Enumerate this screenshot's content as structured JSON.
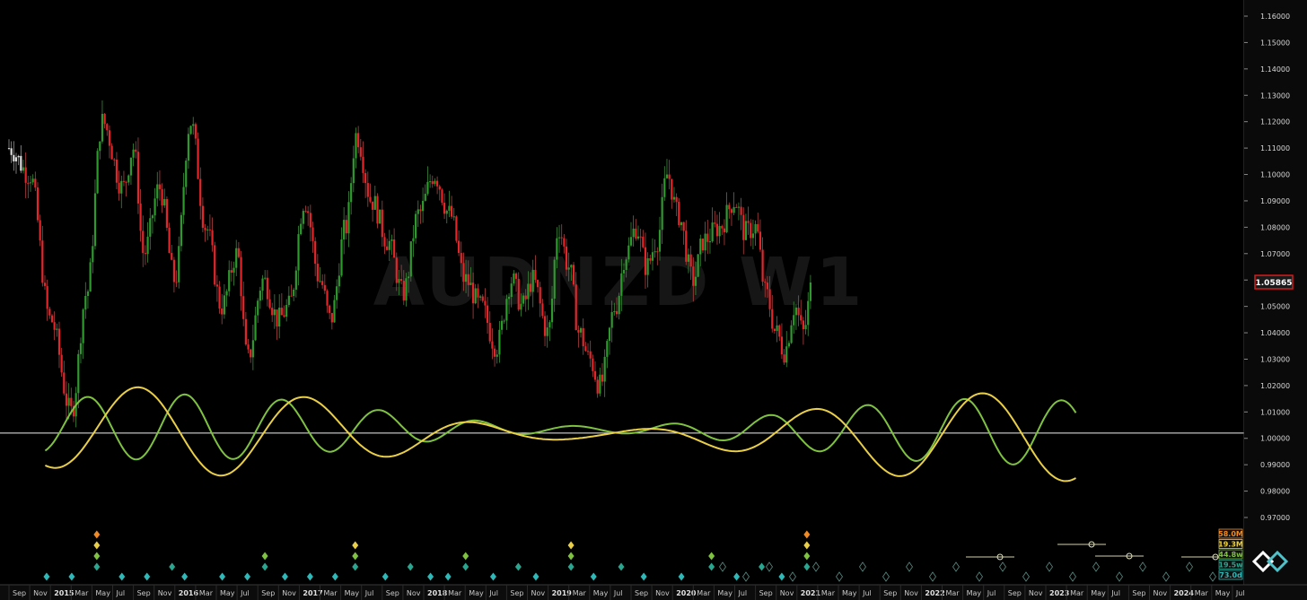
{
  "watermark": "AUDNZD W1",
  "current_price_label": "1.05865",
  "colors": {
    "background": "#000000",
    "bull": "#2e9a2e",
    "bear": "#e3262a",
    "wave_green": "#7fc241",
    "wave_yellow": "#e9cf48",
    "zero_line": "#f0f0f0",
    "price_tag_border": "#d21d1d",
    "marker_orange": "#f08a24",
    "marker_yellow": "#e9cf48",
    "marker_green": "#7fc241",
    "marker_teal": "#2aa58f",
    "marker_cyan": "#2fb8b8"
  },
  "chart_data": {
    "type": "line",
    "title": "AUDNZD W1",
    "y_axis": {
      "ticks": [
        "1.16000",
        "1.15000",
        "1.14000",
        "1.13000",
        "1.12000",
        "1.11000",
        "1.10000",
        "1.09000",
        "1.08000",
        "1.07000",
        "1.06000",
        "1.05000",
        "1.04000",
        "1.03000",
        "1.02000",
        "1.01000",
        "1.00000",
        "0.99000",
        "0.98000",
        "0.97000"
      ],
      "range": [
        0.963,
        1.166
      ]
    },
    "x_axis": {
      "labels": [
        {
          "text": "Sep",
          "year": false
        },
        {
          "text": "Nov",
          "year": false
        },
        {
          "text": "2015",
          "year": true
        },
        {
          "text": "Mar",
          "year": false
        },
        {
          "text": "May",
          "year": false
        },
        {
          "text": "Jul",
          "year": false
        },
        {
          "text": "Sep",
          "year": false
        },
        {
          "text": "Nov",
          "year": false
        },
        {
          "text": "2016",
          "year": true
        },
        {
          "text": "Mar",
          "year": false
        },
        {
          "text": "May",
          "year": false
        },
        {
          "text": "Jul",
          "year": false
        },
        {
          "text": "Sep",
          "year": false
        },
        {
          "text": "Nov",
          "year": false
        },
        {
          "text": "2017",
          "year": true
        },
        {
          "text": "Mar",
          "year": false
        },
        {
          "text": "May",
          "year": false
        },
        {
          "text": "Jul",
          "year": false
        },
        {
          "text": "Sep",
          "year": false
        },
        {
          "text": "Nov",
          "year": false
        },
        {
          "text": "2018",
          "year": true
        },
        {
          "text": "Mar",
          "year": false
        },
        {
          "text": "May",
          "year": false
        },
        {
          "text": "Jul",
          "year": false
        },
        {
          "text": "Sep",
          "year": false
        },
        {
          "text": "Nov",
          "year": false
        },
        {
          "text": "2019",
          "year": true
        },
        {
          "text": "Mar",
          "year": false
        },
        {
          "text": "May",
          "year": false
        },
        {
          "text": "Jul",
          "year": false
        },
        {
          "text": "Sep",
          "year": false
        },
        {
          "text": "Nov",
          "year": false
        },
        {
          "text": "2020",
          "year": true
        },
        {
          "text": "Mar",
          "year": false
        },
        {
          "text": "May",
          "year": false
        },
        {
          "text": "Jul",
          "year": false
        },
        {
          "text": "Sep",
          "year": false
        },
        {
          "text": "Nov",
          "year": false
        },
        {
          "text": "2021",
          "year": true
        },
        {
          "text": "Mar",
          "year": false
        },
        {
          "text": "May",
          "year": false
        },
        {
          "text": "Jul",
          "year": false
        },
        {
          "text": "Sep",
          "year": false
        },
        {
          "text": "Nov",
          "year": false
        },
        {
          "text": "2022",
          "year": true
        },
        {
          "text": "Mar",
          "year": false
        },
        {
          "text": "May",
          "year": false
        },
        {
          "text": "Jul",
          "year": false
        },
        {
          "text": "Sep",
          "year": false
        },
        {
          "text": "Nov",
          "year": false
        },
        {
          "text": "2023",
          "year": true
        },
        {
          "text": "Mar",
          "year": false
        },
        {
          "text": "May",
          "year": false
        },
        {
          "text": "Jul",
          "year": false
        },
        {
          "text": "Sep",
          "year": false
        },
        {
          "text": "Nov",
          "year": false
        },
        {
          "text": "2024",
          "year": true
        },
        {
          "text": "Mar",
          "year": false
        },
        {
          "text": "May",
          "year": false
        },
        {
          "text": "Jul",
          "year": false
        }
      ]
    },
    "price_anchors": [
      {
        "m": 0,
        "v": 1.11
      },
      {
        "m": 2,
        "v": 1.1
      },
      {
        "m": 4,
        "v": 1.045
      },
      {
        "m": 6,
        "v": 1.01
      },
      {
        "m": 7.5,
        "v": 1.055
      },
      {
        "m": 9,
        "v": 1.12
      },
      {
        "m": 11,
        "v": 1.095
      },
      {
        "m": 12,
        "v": 1.11
      },
      {
        "m": 13,
        "v": 1.07
      },
      {
        "m": 14.5,
        "v": 1.095
      },
      {
        "m": 16,
        "v": 1.06
      },
      {
        "m": 17.5,
        "v": 1.12
      },
      {
        "m": 19,
        "v": 1.08
      },
      {
        "m": 20.5,
        "v": 1.05
      },
      {
        "m": 22,
        "v": 1.07
      },
      {
        "m": 23,
        "v": 1.03
      },
      {
        "m": 24.5,
        "v": 1.06
      },
      {
        "m": 26,
        "v": 1.045
      },
      {
        "m": 27,
        "v": 1.05
      },
      {
        "m": 28.5,
        "v": 1.09
      },
      {
        "m": 30,
        "v": 1.06
      },
      {
        "m": 31,
        "v": 1.045
      },
      {
        "m": 32.5,
        "v": 1.08
      },
      {
        "m": 33.5,
        "v": 1.115
      },
      {
        "m": 35,
        "v": 1.09
      },
      {
        "m": 36.5,
        "v": 1.075
      },
      {
        "m": 38,
        "v": 1.055
      },
      {
        "m": 39.5,
        "v": 1.085
      },
      {
        "m": 41,
        "v": 1.1
      },
      {
        "m": 42.5,
        "v": 1.085
      },
      {
        "m": 44,
        "v": 1.06
      },
      {
        "m": 45.5,
        "v": 1.05
      },
      {
        "m": 47,
        "v": 1.035
      },
      {
        "m": 48.5,
        "v": 1.06
      },
      {
        "m": 49.5,
        "v": 1.05
      },
      {
        "m": 50.5,
        "v": 1.06
      },
      {
        "m": 52,
        "v": 1.04
      },
      {
        "m": 53,
        "v": 1.08
      },
      {
        "m": 54,
        "v": 1.065
      },
      {
        "m": 55,
        "v": 1.04
      },
      {
        "m": 56,
        "v": 1.03
      },
      {
        "m": 57,
        "v": 1.02
      },
      {
        "m": 58.5,
        "v": 1.05
      },
      {
        "m": 59.5,
        "v": 1.07
      },
      {
        "m": 60.5,
        "v": 1.08
      },
      {
        "m": 61.5,
        "v": 1.065
      },
      {
        "m": 62.5,
        "v": 1.075
      },
      {
        "m": 63.5,
        "v": 1.1
      },
      {
        "m": 64.5,
        "v": 1.085
      },
      {
        "m": 66,
        "v": 1.06
      },
      {
        "m": 67,
        "v": 1.075
      },
      {
        "m": 68.5,
        "v": 1.08
      },
      {
        "m": 70,
        "v": 1.09
      },
      {
        "m": 71,
        "v": 1.078
      },
      {
        "m": 72,
        "v": 1.08
      },
      {
        "m": 73,
        "v": 1.055
      },
      {
        "m": 74,
        "v": 1.04
      },
      {
        "m": 74.8,
        "v": 1.033
      },
      {
        "m": 75.8,
        "v": 1.05
      },
      {
        "m": 76.6,
        "v": 1.04
      },
      {
        "m": 77.5,
        "v": 1.0587
      }
    ],
    "series": [
      {
        "name": "",
        "color": "#7fc241",
        "points_x_month": [
          3,
          6,
          9,
          12,
          15,
          18,
          21,
          24,
          27,
          30,
          33,
          36,
          39,
          42,
          45,
          48,
          51,
          54,
          57,
          60,
          63,
          66,
          69,
          72,
          75,
          78,
          81,
          84,
          87,
          90,
          93,
          96,
          99,
          102
        ],
        "note": "wave drawn by script from sine parameters below",
        "amplitude": 0.0125,
        "center": 1.0045,
        "period_months": 9.4,
        "phase_month": 5.2,
        "drift": -2e-05,
        "start_month": 3.5,
        "end_month": 103
      },
      {
        "name": "",
        "color": "#e9cf48",
        "amplitude": 0.017,
        "center": 1.003,
        "period_months": 16.3,
        "phase_month": 8.3,
        "drift": -3e-05,
        "start_month": 3.5,
        "end_month": 103
      }
    ],
    "zero_line": 1.002,
    "marker_rows": [
      {
        "color": "#f08a24",
        "months": [
          3.5,
          31.8
        ]
      },
      {
        "color": "#e9cf48",
        "months": [
          3.5,
          13.8,
          22.4,
          31.8
        ]
      },
      {
        "color": "#7fc241",
        "months": [
          3.5,
          10.2,
          13.8,
          18.2,
          22.4,
          28.0,
          31.8
        ]
      },
      {
        "color": "#2aa58f",
        "months": [
          3.5,
          6.5,
          10.2,
          13.8,
          16.0,
          18.2,
          20.3,
          22.4,
          24.4,
          28.0,
          30.0,
          31.8
        ]
      },
      {
        "color": "#2fb8b8",
        "months": [
          1.5,
          2.5,
          4.5,
          5.5,
          7.0,
          8.5,
          9.5,
          11.0,
          12.0,
          13.0,
          15.0,
          16.8,
          17.5,
          19.3,
          21.0,
          23.3,
          25.3,
          26.8,
          29.0,
          30.8
        ]
      }
    ],
    "period_labels": [
      {
        "text": "58.0M",
        "color": "#f08a24"
      },
      {
        "text": "19.3M",
        "color": "#e9cf48"
      },
      {
        "text": "44.8w",
        "color": "#7fc241"
      },
      {
        "text": "19.5w",
        "color": "#2aa58f"
      },
      {
        "text": "73.0d",
        "color": "#2fb8b8"
      }
    ],
    "grid": false,
    "legend": "none"
  }
}
